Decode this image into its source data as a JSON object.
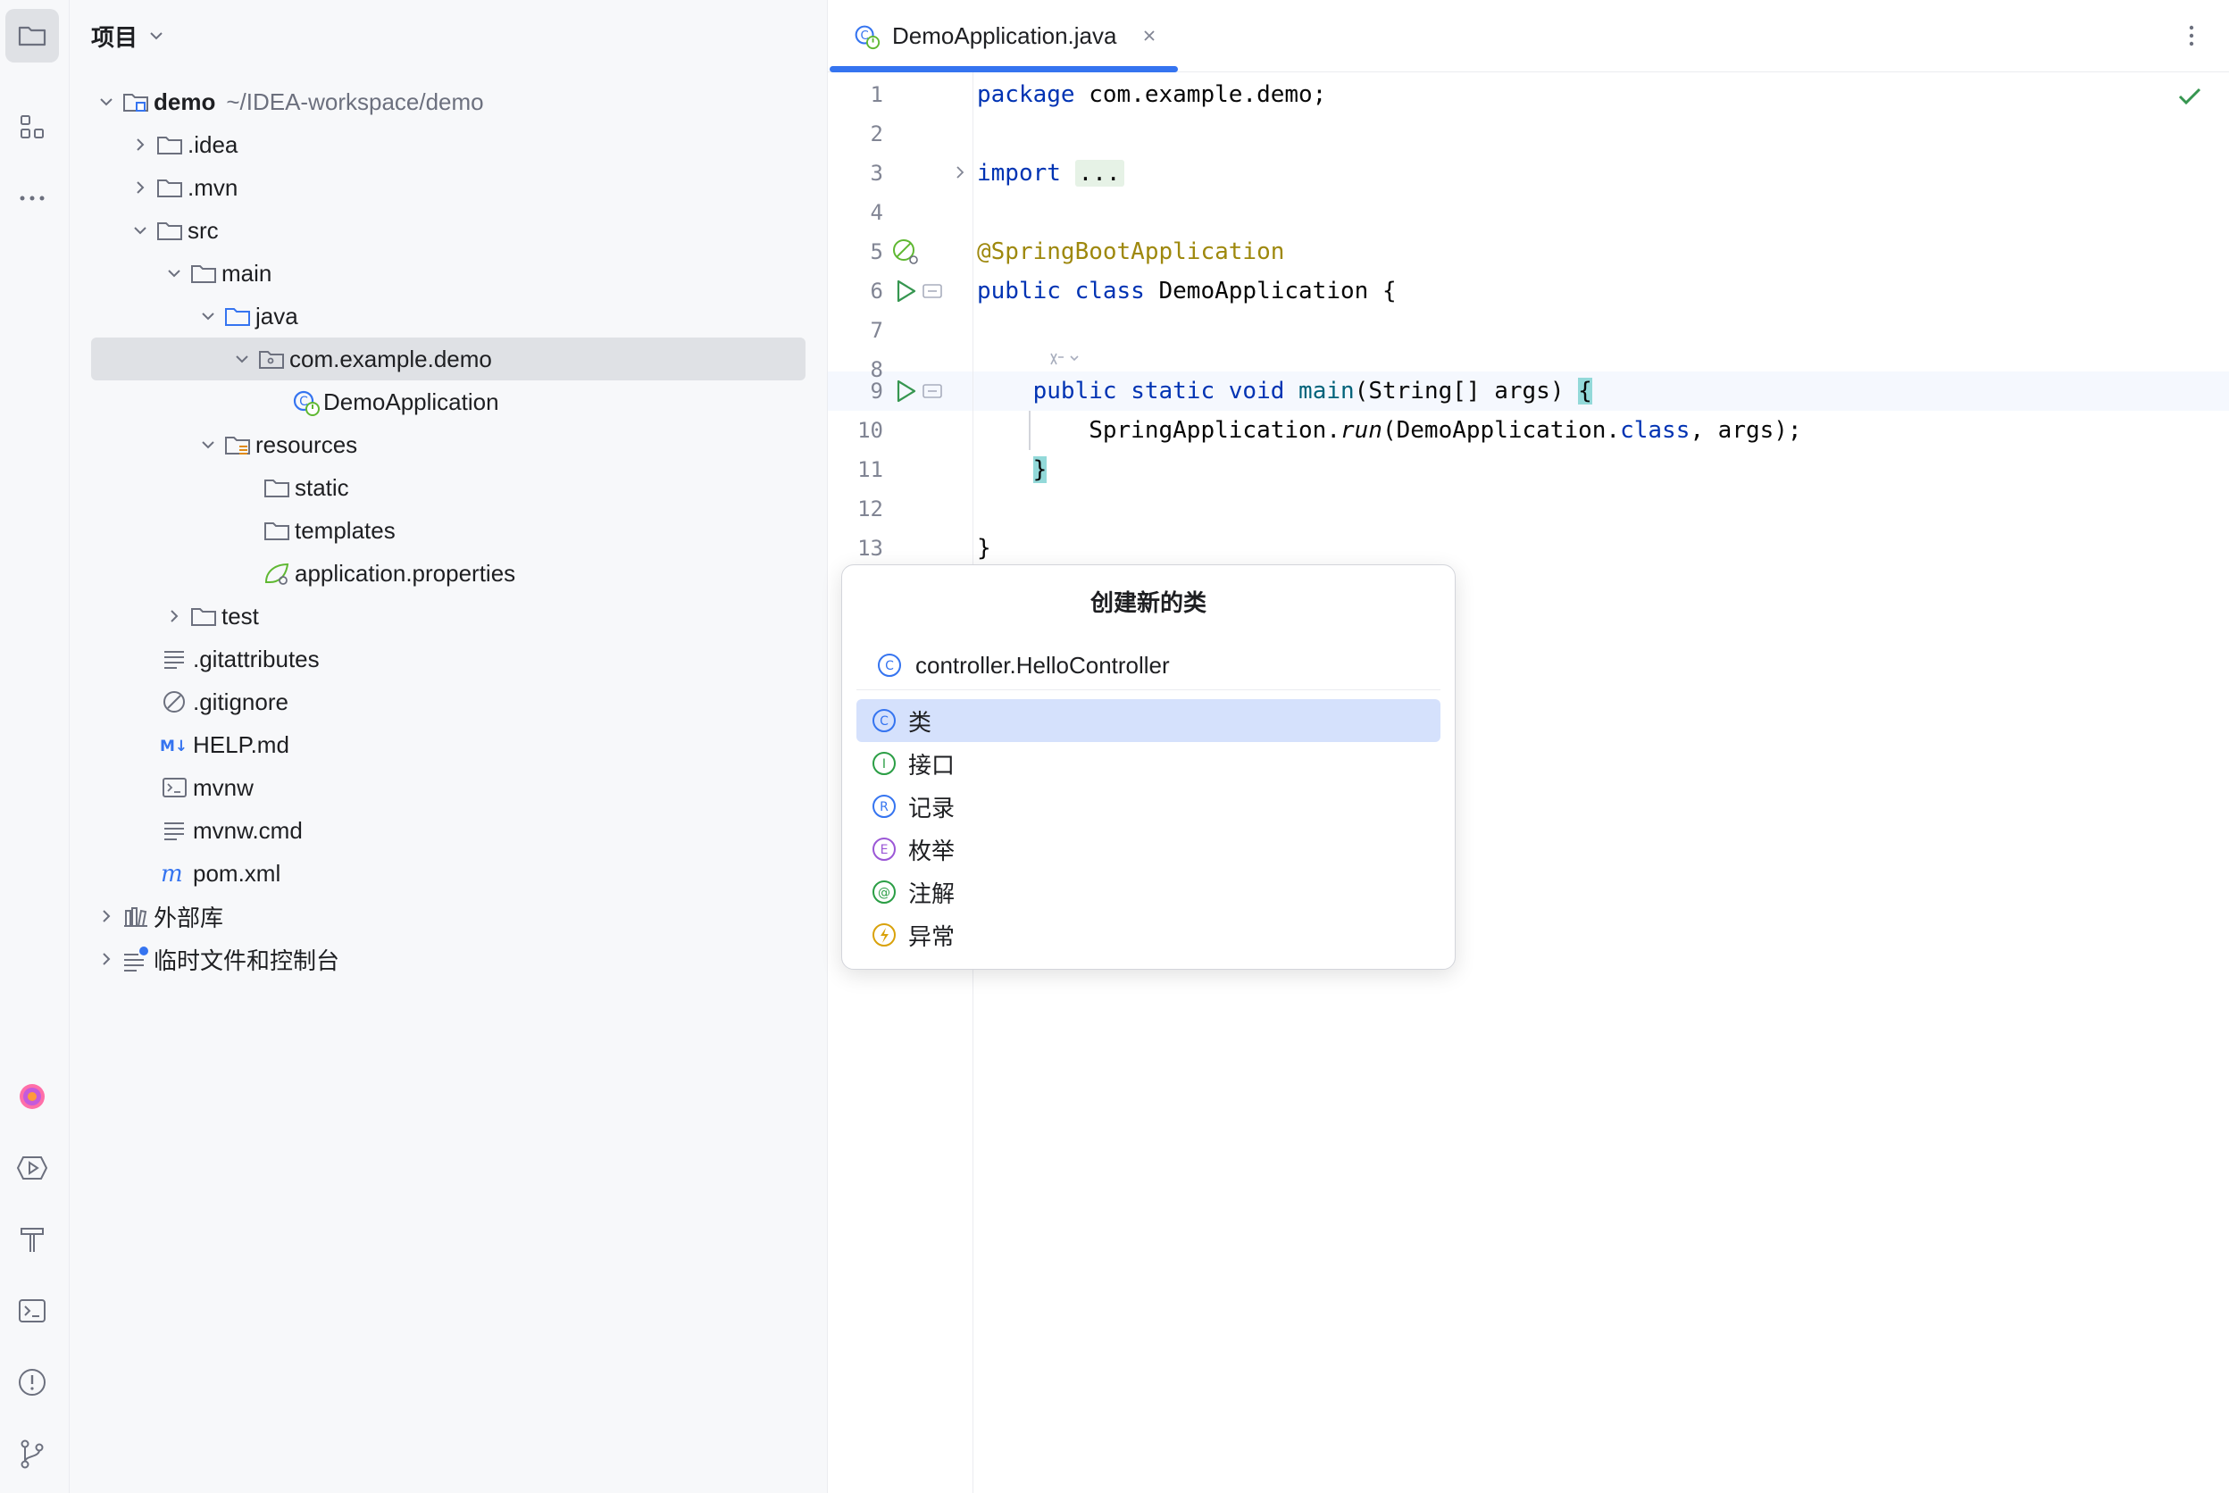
{
  "project_panel": {
    "title": "项目",
    "tree": [
      {
        "label": "demo",
        "hint": "~/IDEA-workspace/demo"
      },
      {
        "label": ".idea"
      },
      {
        "label": ".mvn"
      },
      {
        "label": "src"
      },
      {
        "label": "main"
      },
      {
        "label": "java"
      },
      {
        "label": "com.example.demo"
      },
      {
        "label": "DemoApplication"
      },
      {
        "label": "resources"
      },
      {
        "label": "static"
      },
      {
        "label": "templates"
      },
      {
        "label": "application.properties"
      },
      {
        "label": "test"
      },
      {
        "label": ".gitattributes"
      },
      {
        "label": ".gitignore"
      },
      {
        "label": "HELP.md"
      },
      {
        "label": "mvnw"
      },
      {
        "label": "mvnw.cmd"
      },
      {
        "label": "pom.xml"
      },
      {
        "label": "外部库"
      },
      {
        "label": "临时文件和控制台"
      }
    ]
  },
  "editor": {
    "tab_title": "DemoApplication.java",
    "line_numbers": [
      "1",
      "2",
      "3",
      "4",
      "5",
      "6",
      "7",
      "8",
      "9",
      "10",
      "11",
      "12",
      "13"
    ],
    "code": {
      "l1_kw": "package",
      "l1_rest": " com.example.demo;",
      "l3_kw": "import",
      "l3_fold": "...",
      "l6_ann": "@SpringBootApplication",
      "l7_kw": "public class",
      "l7_rest": " DemoApplication {",
      "l9_indent": "    ",
      "l9_kw": "public static void",
      "l9_fn": "main",
      "l9_rest": "(String[] args) ",
      "l9_brace": "{",
      "l10_a": "        SpringApplication.",
      "l10_it": "run",
      "l10_b": "(DemoApplication.",
      "l10_kw": "class",
      "l10_c": ", args);",
      "l11_indent": "    ",
      "l11_brace": "}",
      "l13": "}"
    }
  },
  "popup": {
    "title": "创建新的类",
    "input_value": "controller.HelloController",
    "items": [
      {
        "label": "类",
        "icon": "class-icon",
        "letter": "C",
        "color": "#3574f0"
      },
      {
        "label": "接口",
        "icon": "interface-icon",
        "letter": "I",
        "color": "#2b9e45"
      },
      {
        "label": "记录",
        "icon": "record-icon",
        "letter": "R",
        "color": "#3574f0"
      },
      {
        "label": "枚举",
        "icon": "enum-icon",
        "letter": "E",
        "color": "#9b57d6"
      },
      {
        "label": "注解",
        "icon": "annotation-icon",
        "letter": "@",
        "color": "#2b9e45"
      },
      {
        "label": "异常",
        "icon": "exception-icon",
        "letter": "⚡",
        "color": "#d9a20b"
      }
    ]
  }
}
